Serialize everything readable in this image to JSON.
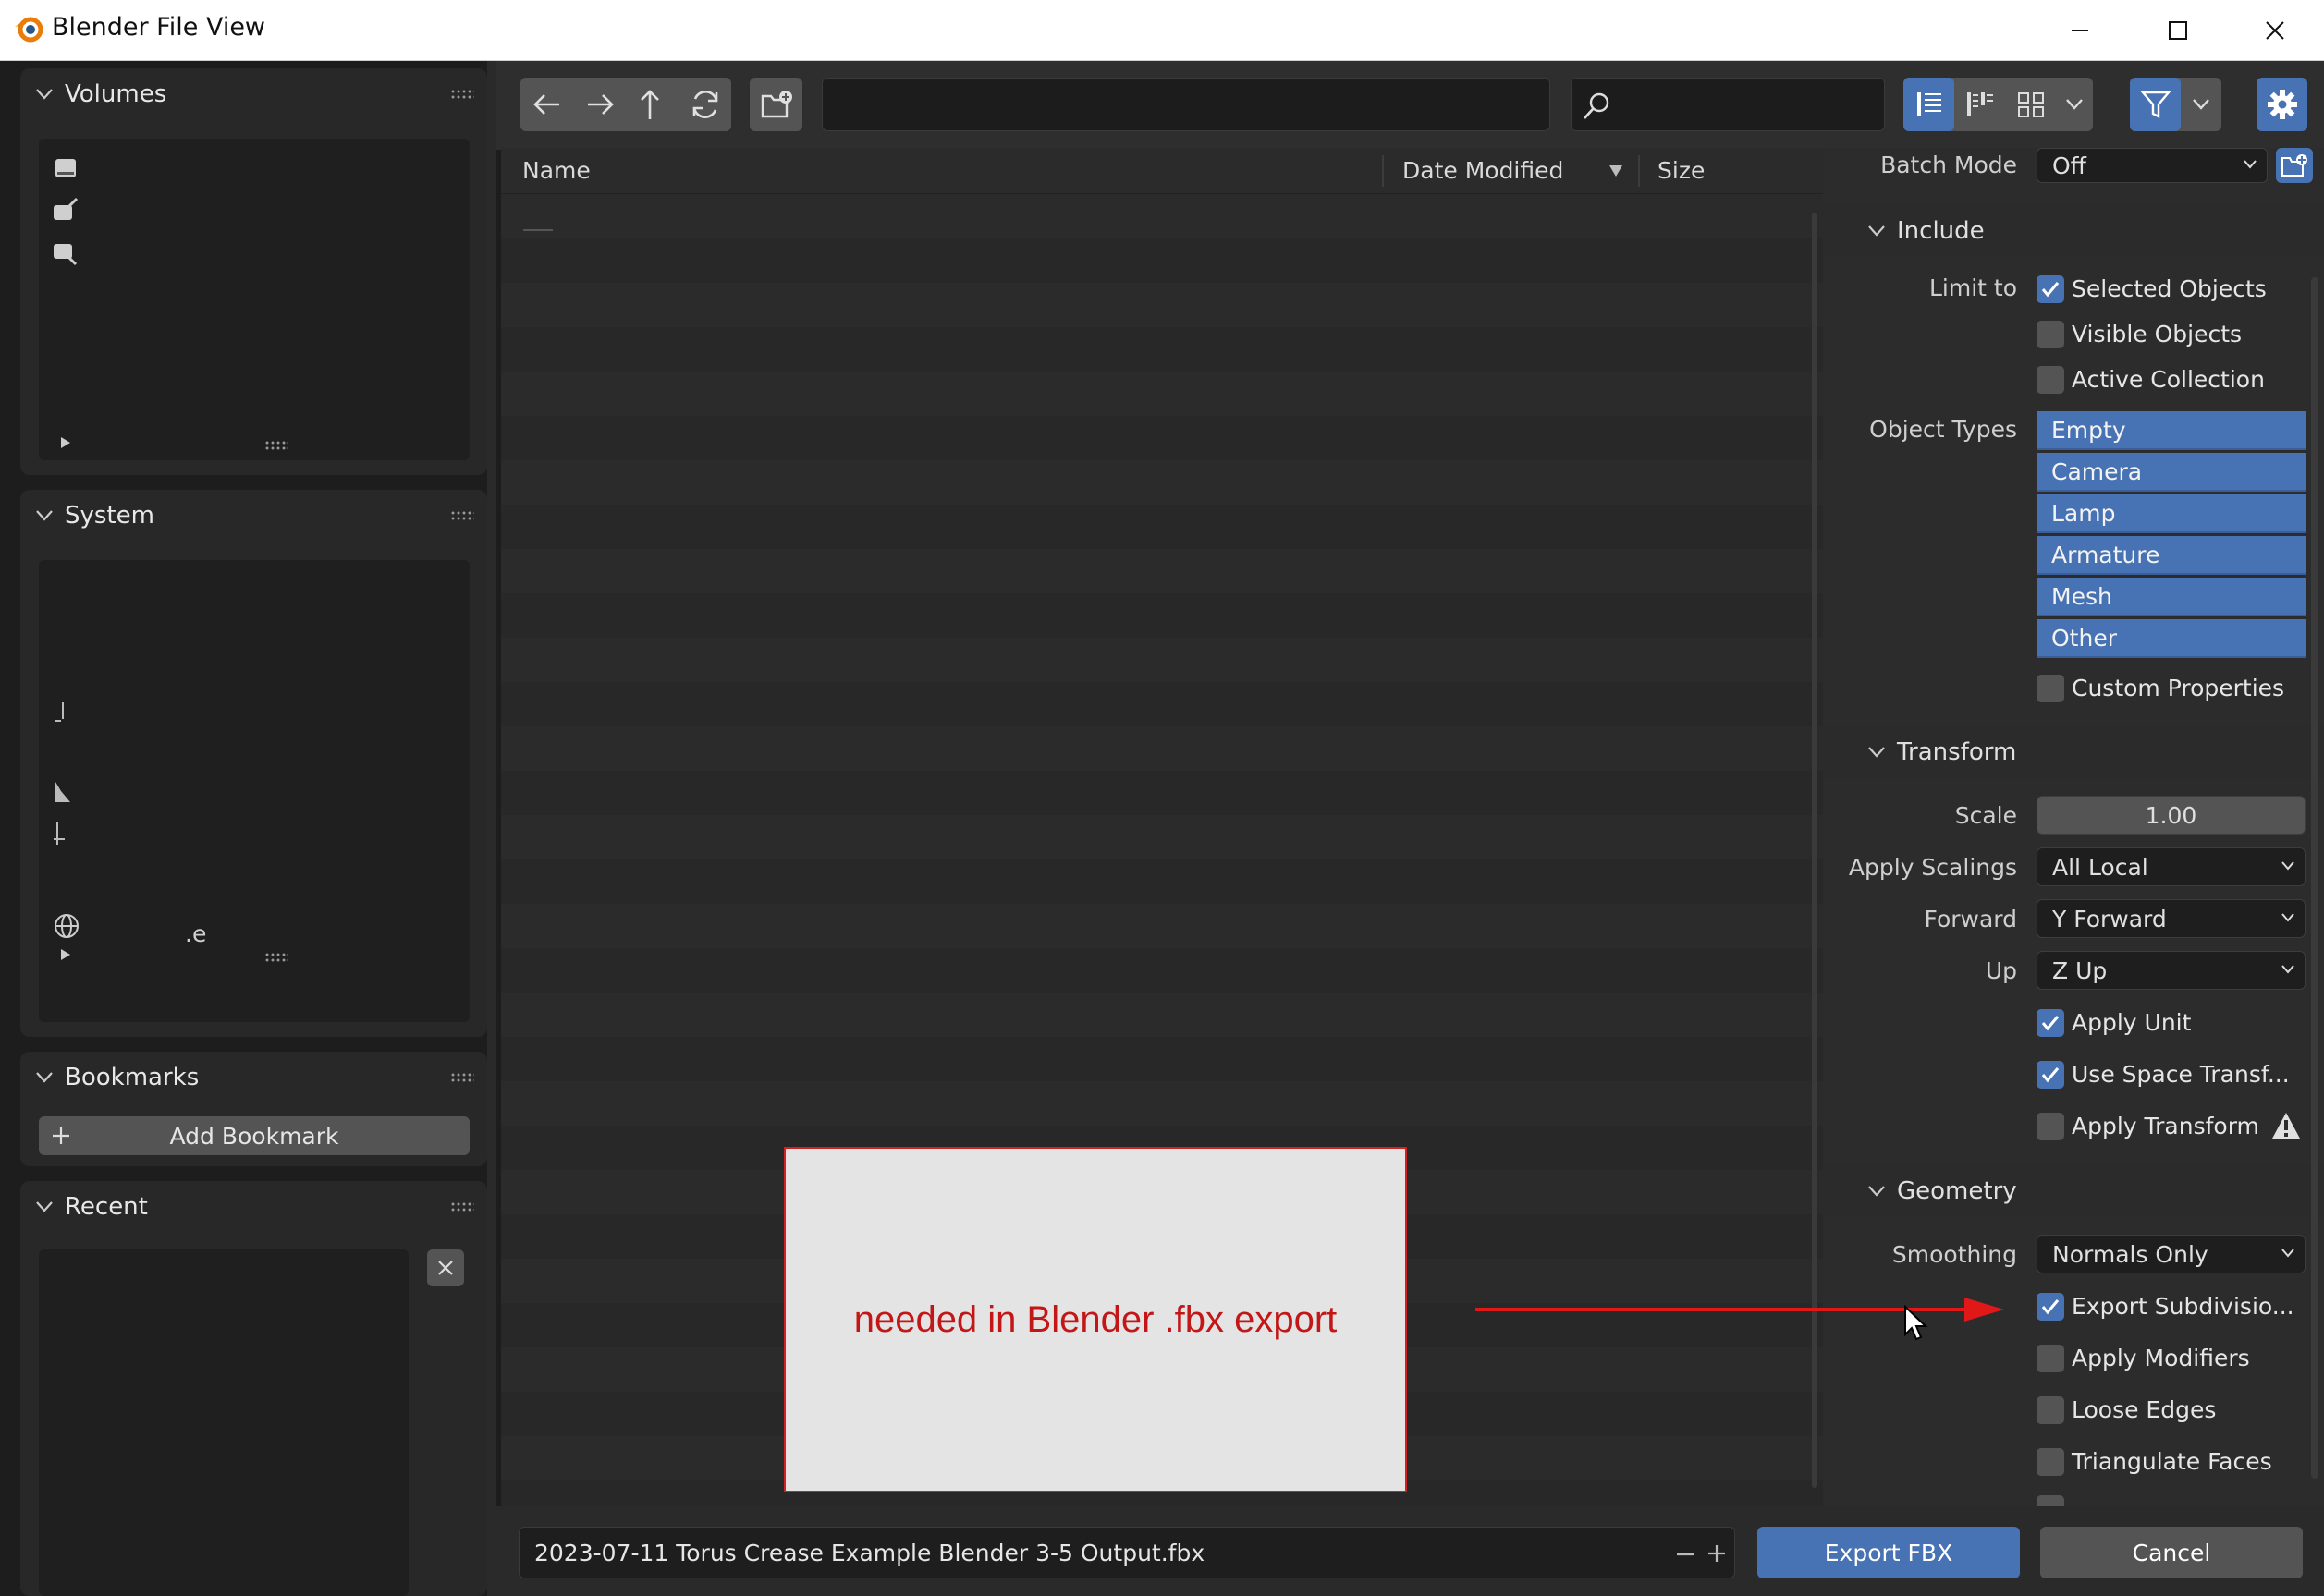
{
  "window": {
    "title": "Blender File View"
  },
  "sidebar": {
    "volumes": {
      "label": "Volumes"
    },
    "system": {
      "label": "System",
      "partial_text": ".e"
    },
    "bookmarks": {
      "label": "Bookmarks",
      "add_label": "Add Bookmark"
    },
    "recent": {
      "label": "Recent"
    }
  },
  "toolbar": {
    "path_value": "",
    "search_placeholder": ""
  },
  "file_list": {
    "columns": [
      "Name",
      "Date Modified",
      "Size"
    ]
  },
  "properties": {
    "batch_mode": {
      "label": "Batch Mode",
      "value": "Off"
    },
    "include": {
      "header": "Include",
      "limit_to_label": "Limit to",
      "selected_objects": {
        "label": "Selected Objects",
        "checked": true
      },
      "visible_objects": {
        "label": "Visible Objects",
        "checked": false
      },
      "active_collection": {
        "label": "Active Collection",
        "checked": false
      },
      "object_types_label": "Object Types",
      "object_types": [
        "Empty",
        "Camera",
        "Lamp",
        "Armature",
        "Mesh",
        "Other"
      ],
      "custom_properties": {
        "label": "Custom Properties",
        "checked": false
      }
    },
    "transform": {
      "header": "Transform",
      "scale_label": "Scale",
      "scale_value": "1.00",
      "apply_scalings_label": "Apply Scalings",
      "apply_scalings_value": "All Local",
      "forward_label": "Forward",
      "forward_value": "Y Forward",
      "up_label": "Up",
      "up_value": "Z Up",
      "apply_unit": {
        "label": "Apply Unit",
        "checked": true
      },
      "use_space_transform": {
        "label": "Use Space Transf...",
        "checked": true
      },
      "apply_transform": {
        "label": "Apply Transform",
        "checked": false
      }
    },
    "geometry": {
      "header": "Geometry",
      "smoothing_label": "Smoothing",
      "smoothing_value": "Normals Only",
      "export_subdivision": {
        "label": "Export Subdivisio...",
        "checked": true
      },
      "apply_modifiers": {
        "label": "Apply Modifiers",
        "checked": false
      },
      "loose_edges": {
        "label": "Loose Edges",
        "checked": false
      },
      "triangulate_faces": {
        "label": "Triangulate Faces",
        "checked": false
      }
    }
  },
  "bottom": {
    "filename": "2023-07-11 Torus Crease Example Blender 3-5 Output.fbx",
    "export_label": "Export FBX",
    "cancel_label": "Cancel"
  },
  "annotation": {
    "text": "needed in Blender .fbx export",
    "color": "#c31717"
  },
  "colors": {
    "accent": "#4772b3",
    "annotation_border": "#d32020",
    "arrow": "#e01818"
  }
}
